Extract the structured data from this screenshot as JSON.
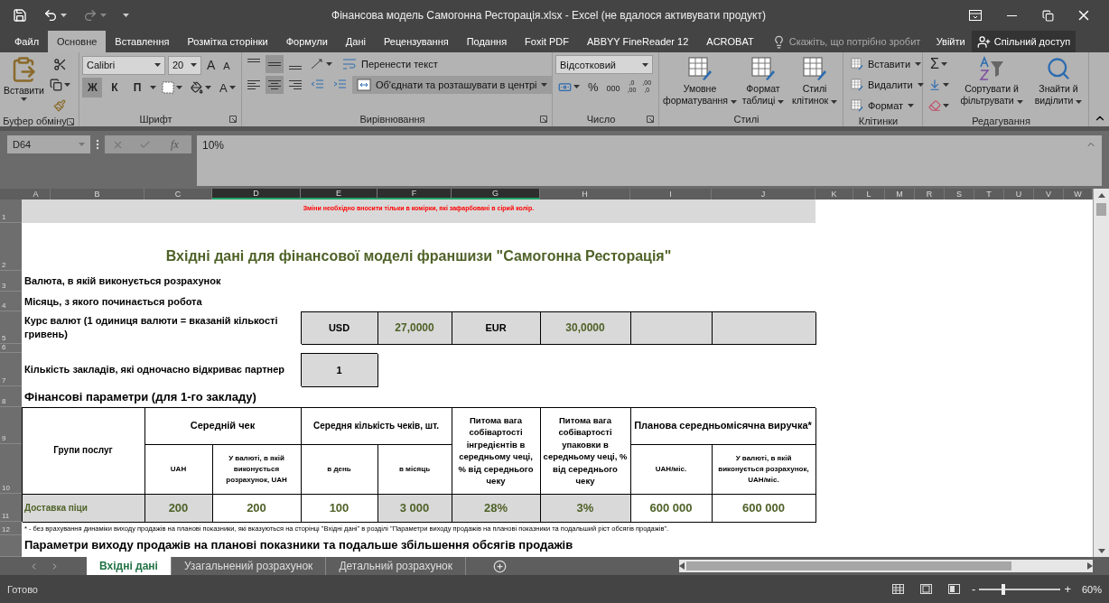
{
  "window": {
    "title": "Фінансова модель Самогонна Ресторація.xlsx - Excel (не вдалося активувати продукт)"
  },
  "menu_tabs": [
    {
      "label": "Файл",
      "selected": false
    },
    {
      "label": "Основне",
      "selected": true
    },
    {
      "label": "Вставлення",
      "selected": false
    },
    {
      "label": "Розмітка сторінки",
      "selected": false
    },
    {
      "label": "Формули",
      "selected": false
    },
    {
      "label": "Дані",
      "selected": false
    },
    {
      "label": "Рецензування",
      "selected": false
    },
    {
      "label": "Подання",
      "selected": false
    },
    {
      "label": "Foxit PDF",
      "selected": false
    },
    {
      "label": "ABBYY FineReader 12",
      "selected": false
    },
    {
      "label": "ACROBAT",
      "selected": false
    }
  ],
  "tell_me": {
    "placeholder": "Скажіть, що потрібно зробит"
  },
  "sign_in": "Увійти",
  "share": "Спільний доступ",
  "ribbon": {
    "clipboard": {
      "paste": "Вставити",
      "label": "Буфер обміну"
    },
    "font": {
      "name": "Calibri",
      "size": "20",
      "grow": "A",
      "shrink": "A",
      "toggles": [
        {
          "label": "Ж",
          "selected": true
        },
        {
          "label": "К",
          "selected": false
        },
        {
          "label": "П",
          "selected": false
        }
      ],
      "font_color": "A",
      "label": "Шрифт"
    },
    "alignment": {
      "vertical": [
        {
          "selected": false
        },
        {
          "selected": true
        },
        {
          "selected": false
        }
      ],
      "horizontal": [
        {
          "selected": false
        },
        {
          "selected": true
        },
        {
          "selected": false
        }
      ],
      "wrap": "Перенести текст",
      "merge": {
        "label": "Об'єднати та розташувати в центрі",
        "selected": true
      },
      "label": "Вирівнювання"
    },
    "number": {
      "format": "Відсотковий",
      "percent": "%",
      "thousands": "000",
      "decimals": [
        {
          "top": ",0",
          "bottom": ",00"
        },
        {
          "top": ",00",
          "bottom": ",0"
        }
      ],
      "label": "Число"
    },
    "styles": {
      "buttons": [
        "Умовне форматування",
        "Формат таблиці",
        "Стилі клітинок"
      ],
      "label": "Стилі"
    },
    "cells": {
      "buttons": [
        "Вставити",
        "Видалити",
        "Формат"
      ],
      "label": "Клітинки"
    },
    "editing": {
      "sum": "Σ",
      "buttons": [
        "Сортувати й фільтрувати",
        "Знайти й виділити"
      ],
      "label": "Редагування"
    }
  },
  "formula_bar": {
    "name_box": "D64",
    "fx": "fx",
    "value": "10%"
  },
  "columns": [
    {
      "label": "A",
      "selected": false
    },
    {
      "label": "B",
      "selected": false
    },
    {
      "label": "C",
      "selected": false
    },
    {
      "label": "D",
      "selected": true
    },
    {
      "label": "E",
      "selected": true
    },
    {
      "label": "F",
      "selected": true
    },
    {
      "label": "G",
      "selected": true
    },
    {
      "label": "H",
      "selected": false
    },
    {
      "label": "I",
      "selected": false
    },
    {
      "label": "J",
      "selected": false
    },
    {
      "label": "K",
      "selected": false
    },
    {
      "label": "L",
      "selected": false
    },
    {
      "label": "M",
      "selected": false
    },
    {
      "label": "R",
      "selected": false
    },
    {
      "label": "S",
      "selected": false
    },
    {
      "label": "T",
      "selected": false
    },
    {
      "label": "U",
      "selected": false
    },
    {
      "label": "V",
      "selected": false
    },
    {
      "label": "W",
      "selected": false
    }
  ],
  "row_numbers": [
    "1",
    "2",
    "3",
    "4",
    "5",
    "6",
    "7",
    "8",
    "9",
    "10",
    "11",
    "12"
  ],
  "sheet": {
    "notice": "Зміни необхідно вносити тільки в комірки, які зафарбовані в сірий колір.",
    "title": "Вхідні дані для фінансової моделі франшизи \"Самогонна Ресторація\"",
    "currency_label": "Валюта, в якій виконується розрахунок",
    "start_month_label": "Місяць, з якого починається робота",
    "exchange": {
      "label": "Курс валют (1 одиниця валюти = вказаній кількості гривень)",
      "cells": [
        {
          "text": "USD",
          "kind": "currency"
        },
        {
          "text": "27,0000",
          "kind": "rate"
        },
        {
          "text": "EUR",
          "kind": "currency"
        },
        {
          "text": "30,0000",
          "kind": "rate"
        }
      ]
    },
    "outlets": {
      "label": "Кількість закладів, які одночасно відкриває партнер",
      "value": "1"
    },
    "section": "Фінансові параметри (для 1-го закладу)",
    "table": {
      "group_header": "Групи послуг",
      "avg_check": "Середній чек",
      "avg_count": "Середня кількість чеків, шт.",
      "ingredients": "Питома вага собівартості інгредієнтів в середньому чеці, % від середнього чеку",
      "packaging": "Питома вага собівартості упаковки в середньому чеці, % від середнього чеку",
      "revenue": "Планова середньомісячна виручка*",
      "subheaders": [
        "UAH",
        "У валюті, в якій виконується розрахунок, UAH",
        "в день",
        "в місяць",
        "UAH/міс.",
        "У валюті, в якій виконується розрахунок, UAH/міс."
      ],
      "row": [
        {
          "text": "Доставка піци",
          "shaded": true
        },
        {
          "text": "200",
          "shaded": true
        },
        {
          "text": "200",
          "shaded": false
        },
        {
          "text": "100",
          "shaded": false
        },
        {
          "text": "3 000",
          "shaded": true
        },
        {
          "text": "28%",
          "shaded": true
        },
        {
          "text": "3%",
          "shaded": true
        },
        {
          "text": "600 000",
          "shaded": false
        },
        {
          "text": "600 000",
          "shaded": false
        }
      ]
    },
    "footnote": "* - без врахування динаміки виходу продажів на планові показники, які вказуються на сторінці \"Вхідні дані\" в розділі \"Параметри виходу продажів на планові показники та подальший ріст обсягів продажів\".",
    "next_section": "Параметри виходу продажів на планові показники та подальше збільшення обсягів продажів"
  },
  "sheet_tabs": [
    {
      "label": "Вхідні дані",
      "selected": true
    },
    {
      "label": "Узагальнений розрахунок",
      "selected": false
    },
    {
      "label": "Детальний розрахунок",
      "selected": false
    }
  ],
  "status": {
    "text": "Готово",
    "zoom_out": "-",
    "zoom_in": "+",
    "zoom": {
      "level": 0.3,
      "text": "60%"
    }
  }
}
